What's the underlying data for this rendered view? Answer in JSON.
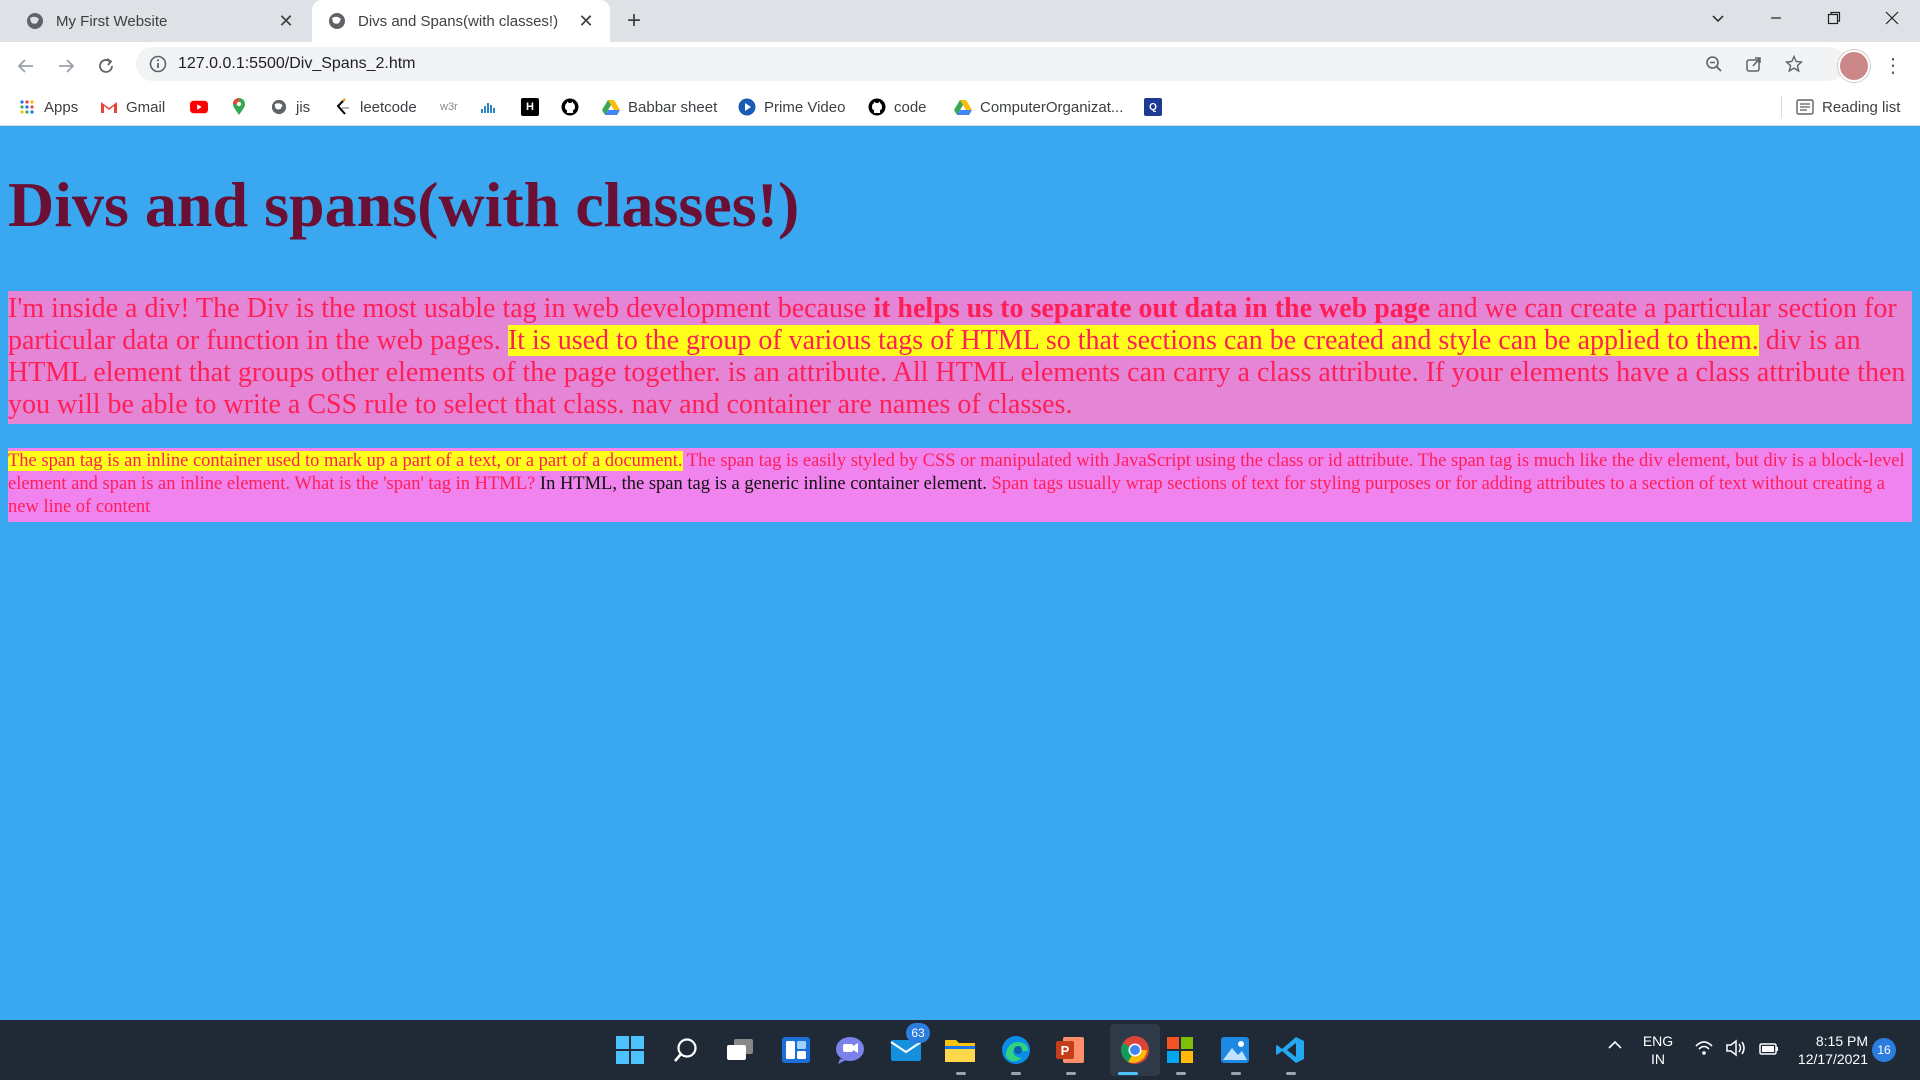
{
  "browser": {
    "tabs": [
      {
        "title": "My First Website",
        "active": false
      },
      {
        "title": "Divs and Spans(with classes!)",
        "active": true
      }
    ],
    "url": "127.0.0.1:5500/Div_Spans_2.htm",
    "bookmarks": [
      {
        "label": "Apps",
        "icon": "apps-grid-icon"
      },
      {
        "label": "Gmail",
        "icon": "gmail-icon"
      },
      {
        "label": "",
        "icon": "youtube-icon"
      },
      {
        "label": "",
        "icon": "maps-pin-icon"
      },
      {
        "label": "jis",
        "icon": "globe-icon"
      },
      {
        "label": "leetcode",
        "icon": "leetcode-icon"
      },
      {
        "label": "w3r",
        "icon": "w3r-icon"
      },
      {
        "label": "",
        "icon": "chart-icon"
      },
      {
        "label": "",
        "icon": "hackerrank-icon"
      },
      {
        "label": "",
        "icon": "github-icon"
      },
      {
        "label": "Babbar sheet",
        "icon": "drive-icon"
      },
      {
        "label": "Prime Video",
        "icon": "prime-video-icon"
      },
      {
        "label": "code",
        "icon": "github-icon"
      },
      {
        "label": "ComputerOrganizat...",
        "icon": "drive-icon"
      },
      {
        "label": "",
        "icon": "search-box-icon"
      }
    ],
    "reading_list": "Reading list"
  },
  "page": {
    "heading": "Divs and spans(with classes!)",
    "div1": {
      "part1": "I'm inside a div! The Div is the most usable tag in web development because ",
      "bold": "it helps us to separate out data in the web page",
      "part2": " and we can create a particular section for particular data or function in the web pages. ",
      "highlight": "It is used to the group of various tags of HTML so that sections can be created and style can be applied to them.",
      "part3": " div is an HTML element that groups other elements of the page together. is an attribute. All HTML elements can carry a class attribute. If your elements have a class attribute then you will be able to write a CSS rule to select that class. nav and container are names of classes."
    },
    "div2": {
      "highlight": "The span tag is an inline container used to mark up a part of a text, or a part of a document.",
      "part1": " The span tag is easily styled by CSS or manipulated with JavaScript using the class or id attribute. The span tag is much like the div element, but div is a block-level element and span is an inline element. What is the 'span' tag in HTML? ",
      "dark": "In HTML, the span tag is a generic inline container element.",
      "part2": " Span tags usually wrap sections of text for styling purposes or for adding attributes to a section of text without creating a new line of content"
    }
  },
  "taskbar": {
    "mail_badge": "63",
    "language_line1": "ENG",
    "language_line2": "IN",
    "time": "8:15 PM",
    "date": "12/17/2021",
    "notification_count": "16"
  },
  "colors": {
    "page_background": "#3aa8f0",
    "heading": "#6b1035",
    "text_pink": "#ff1f57",
    "highlight": "#ffff1a",
    "div1_background": "#e585d6",
    "div2_background": "#f083ee"
  }
}
